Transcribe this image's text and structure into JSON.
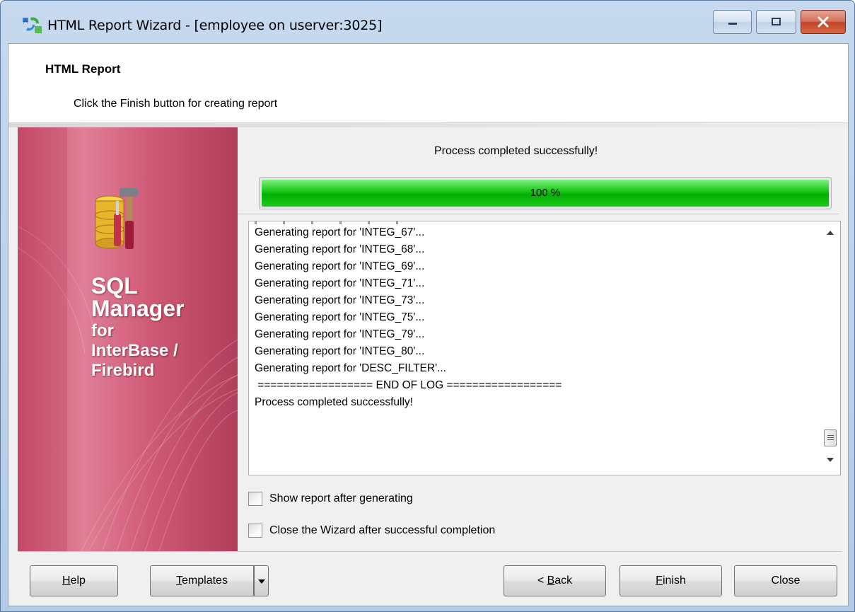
{
  "window": {
    "title": "HTML Report Wizard - [employee on userver:3025]",
    "icon": "report-wizard-icon"
  },
  "header": {
    "title": "HTML Report",
    "subtitle": "Click the Finish button for creating report"
  },
  "banner": {
    "line1": "SQL",
    "line2": "Manager",
    "line3": "for",
    "line4": "InterBase /",
    "line5": "Firebird",
    "icon": "database-tools-icon"
  },
  "status": {
    "message": "Process completed successfully!",
    "progress_percent": 100,
    "progress_text": "100 %",
    "progress_color": "#13c413"
  },
  "log": {
    "lines": [
      "Generating report for 'INTEG_67'...",
      "Generating report for 'INTEG_68'...",
      "Generating report for 'INTEG_69'...",
      "Generating report for 'INTEG_71'...",
      "Generating report for 'INTEG_73'...",
      "Generating report for 'INTEG_75'...",
      "Generating report for 'INTEG_79'...",
      "Generating report for 'INTEG_80'...",
      "Generating report for 'DESC_FILTER'...",
      " ================== END OF LOG ==================",
      "Process completed successfully!"
    ]
  },
  "options": {
    "show_report": {
      "label": "Show report after generating",
      "checked": false
    },
    "close_wizard": {
      "label": "Close the Wizard after successful completion",
      "checked": false
    }
  },
  "buttons": {
    "help": {
      "accel": "H",
      "rest": "elp"
    },
    "templates": {
      "accel": "T",
      "rest": "emplates"
    },
    "back": {
      "prefix": "< ",
      "accel": "B",
      "rest": "ack"
    },
    "finish": {
      "accel": "F",
      "rest": "inish"
    },
    "close": "Close"
  }
}
